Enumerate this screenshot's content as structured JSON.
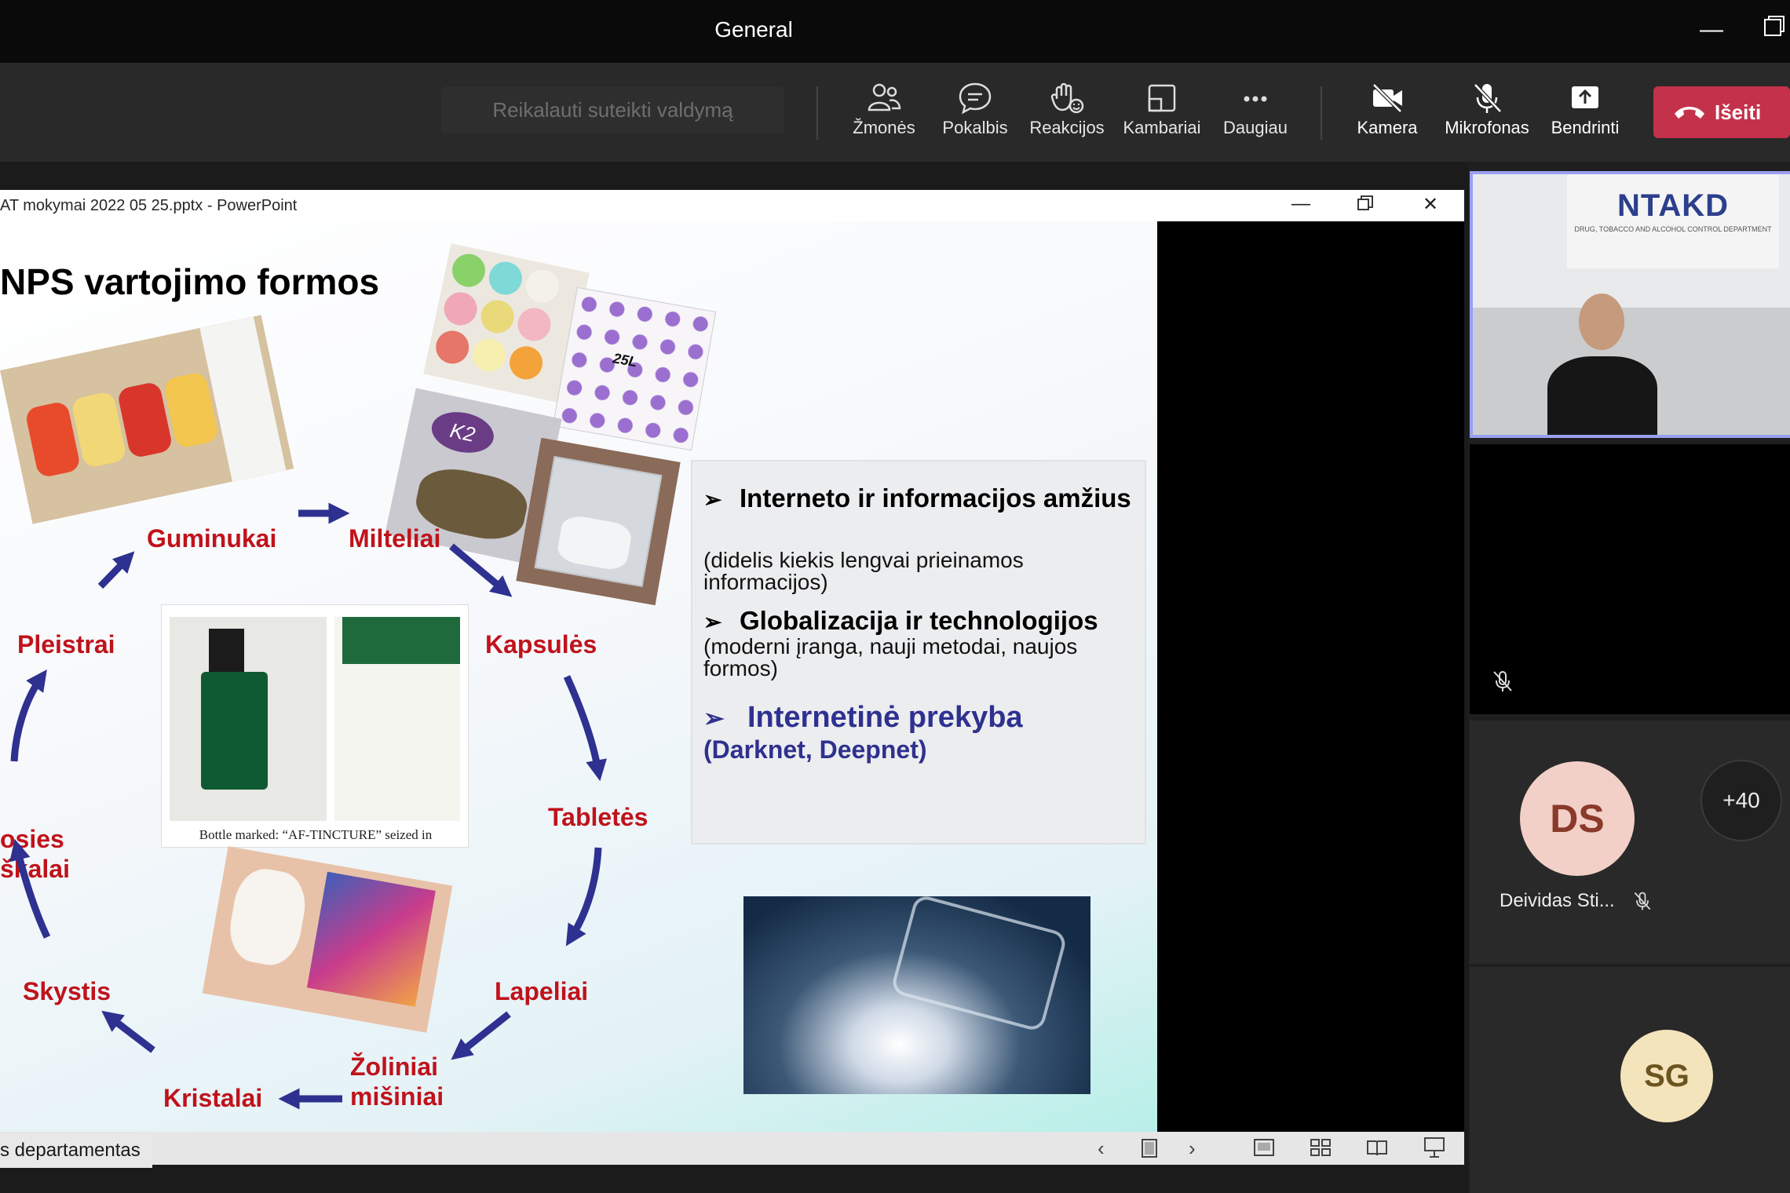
{
  "window": {
    "title": "General"
  },
  "toolbar": {
    "request_control": "Reikalauti suteikti valdymą",
    "people": "Žmonės",
    "chat": "Pokalbis",
    "reactions": "Reakcijos",
    "rooms": "Kambariai",
    "more": "Daugiau",
    "camera": "Kamera",
    "mic": "Mikrofonas",
    "share": "Bendrinti",
    "leave": "Išeiti"
  },
  "ppt": {
    "title": "AT mokymai 2022 05 25.pptx - PowerPoint"
  },
  "slide": {
    "title": "NPS vartojimo formos",
    "forms": {
      "guminukai": "Guminukai",
      "milteliai": "Milteliai",
      "kapsules": "Kapsulės",
      "tabletes": "Tabletės",
      "lapeliai": "Lapeliai",
      "zoliniai_1": "Žoliniai",
      "zoliniai_2": "mišiniai",
      "kristalai": "Kristalai",
      "skystis": "Skystis",
      "left_partial_1": "osies",
      "left_partial_2": "škalai",
      "pleistrai": "Pleistrai"
    },
    "bottle_caption": "Bottle marked: “AF-TINCTURE” seized in",
    "blotter_number": "25L",
    "infobox": {
      "h1": "Interneto ir informacijos amžius",
      "s1": "(didelis kiekis lengvai prieinamos informacijos)",
      "h2": "Globalizacija ir technologijos",
      "s2": "(moderni įranga, nauji metodai, naujos formos)",
      "h3": "Internetinė prekyba",
      "s3": "(Darknet, Deepnet)"
    }
  },
  "presenter_label": "s departamentas",
  "participants": {
    "video_logo": "NTAKD",
    "video_logo_sub": "DRUG, TOBACCO AND ALCOHOL CONTROL DEPARTMENT",
    "ds_initials": "DS",
    "ds_name": "Deividas Sti...",
    "more_count": "+40",
    "sg_initials": "SG"
  },
  "colors": {
    "accent_red": "#c0121b",
    "accent_blue": "#2e318f",
    "leave_red": "#c4314b",
    "tile_border": "#9a9ff0",
    "ds_bg": "#f2d0c8",
    "ds_fg": "#8a3a2a",
    "sg_bg": "#f4e4bc",
    "sg_fg": "#6b5420"
  }
}
